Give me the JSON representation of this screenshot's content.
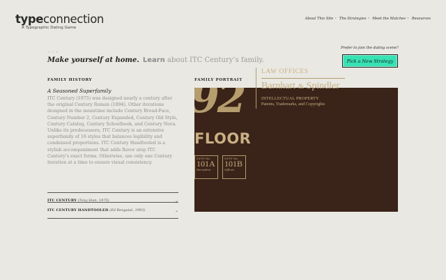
{
  "brand": {
    "title_bold": "type",
    "title_light": "connection",
    "tagline": "A Typographic Dating Game"
  },
  "nav": [
    "About This Site",
    "The Strategies",
    "Meet the Matches",
    "Resources"
  ],
  "nav_sep": "•",
  "progress_dots": "• • •",
  "headline": {
    "lead": "Make yourself at home.",
    "action": "Learn",
    "rest": "about ITC Century’s family."
  },
  "cta": {
    "prompt": "Prefer to join the dating scene?",
    "button": "Pick a New Strategy"
  },
  "family_history": {
    "label": "FAMILY HISTORY",
    "title": "A Seasoned Superfamily",
    "body": "ITC Century (1975) was designed nearly a century after the original Century Roman (1894). Other iterations designed in the meantime include Century Broad-Face, Century Number 2, Century Expanded, Century Old Style, Century Catalog, Century Schoolbook, and Century Nova. Unlike its predecessors, ITC Century is an extensive superfamily of 16 styles that balances legibility and condensed proportions. ITC Century Handtooled is a stylish accompaniment that adds flavor atop ITC Century’s exact forms. Otherwise, use only one Century iteration at a time to ensure visual consistency."
  },
  "accordion": [
    {
      "name": "ITC CENTURY",
      "credit": "(Tony Stan, 1975)"
    },
    {
      "name": "ITC CENTURY HANDTOOLED",
      "credit": "(Ed Benguiat, 1993)"
    }
  ],
  "chevron": "⌄",
  "family_portrait": {
    "label": "FAMILY PORTRAIT",
    "number": "92",
    "floor": "FLOOR",
    "suites": [
      {
        "suite_label": "SUITE No.",
        "number": "101A",
        "desc": "Reception"
      },
      {
        "suite_label": "SUITE No.",
        "number": "101B",
        "desc": "Offices"
      }
    ],
    "law_offices": "LAW OFFICES",
    "firm_a": "Barnhart",
    "firm_amp": "&",
    "firm_b": "Spindler",
    "ip_line1": "INTELLECTUAL PROPERTY",
    "ip_line2": "Patents, Trademarks, and Copyrights"
  },
  "colors": {
    "background": "#e9e8e2",
    "cta": "#37e2b4",
    "portrait_bg": "#3a2318",
    "gold": "#c8b085"
  }
}
